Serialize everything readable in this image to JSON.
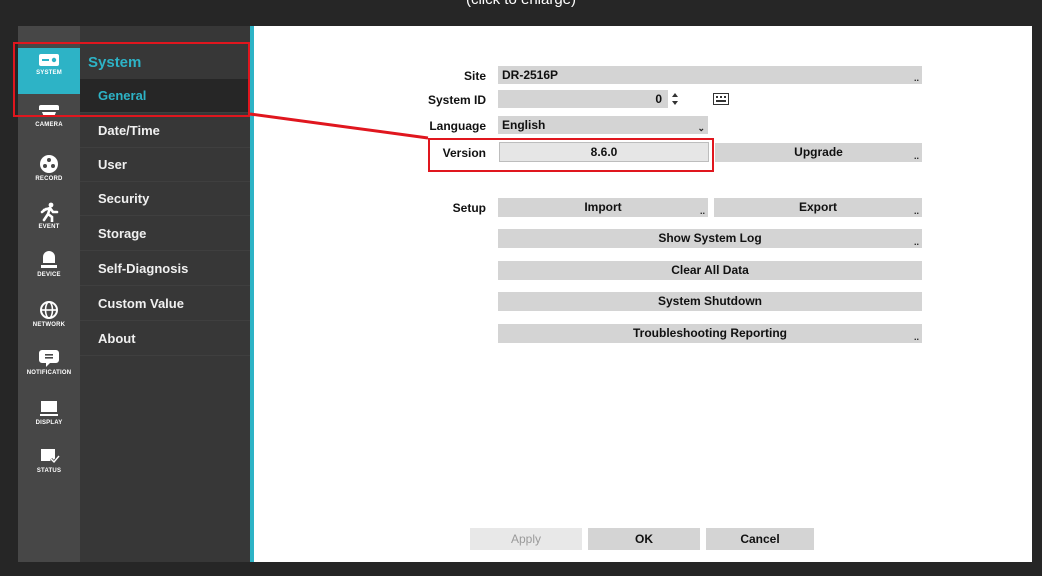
{
  "caption": "(click to enlarge)",
  "icon_strip": [
    {
      "label": "SYSTEM",
      "icon": "system-icon",
      "active": true
    },
    {
      "label": "CAMERA",
      "icon": "camera-icon",
      "active": false
    },
    {
      "label": "RECORD",
      "icon": "record-icon",
      "active": false
    },
    {
      "label": "EVENT",
      "icon": "event-icon",
      "active": false
    },
    {
      "label": "DEVICE",
      "icon": "device-icon",
      "active": false
    },
    {
      "label": "NETWORK",
      "icon": "network-icon",
      "active": false
    },
    {
      "label": "NOTIFICATION",
      "icon": "notification-icon",
      "active": false
    },
    {
      "label": "DISPLAY",
      "icon": "display-icon",
      "active": false
    },
    {
      "label": "STATUS",
      "icon": "status-icon",
      "active": false
    }
  ],
  "menu": {
    "title": "System",
    "items": [
      {
        "label": "General",
        "active": true
      },
      {
        "label": "Date/Time",
        "active": false
      },
      {
        "label": "User",
        "active": false
      },
      {
        "label": "Security",
        "active": false
      },
      {
        "label": "Storage",
        "active": false
      },
      {
        "label": "Self-Diagnosis",
        "active": false
      },
      {
        "label": "Custom Value",
        "active": false
      },
      {
        "label": "About",
        "active": false
      }
    ]
  },
  "form": {
    "site_label": "Site",
    "site_value": "DR-2516P",
    "system_id_label": "System ID",
    "system_id_value": "0",
    "language_label": "Language",
    "language_value": "English",
    "version_label": "Version",
    "version_value": "8.6.0",
    "upgrade_button": "Upgrade",
    "setup_label": "Setup",
    "import_button": "Import",
    "export_button": "Export",
    "show_system_log_button": "Show System Log",
    "clear_all_data_button": "Clear All Data",
    "system_shutdown_button": "System Shutdown",
    "troubleshooting_button": "Troubleshooting Reporting",
    "more_indicator": "..",
    "dropdown_indicator": "⌄"
  },
  "footer": {
    "apply_button": "Apply",
    "ok_button": "OK",
    "cancel_button": "Cancel"
  },
  "colors": {
    "accent": "#2db3c6",
    "highlight": "#e0161e",
    "sidebar": "#474747",
    "menu": "#373737"
  }
}
